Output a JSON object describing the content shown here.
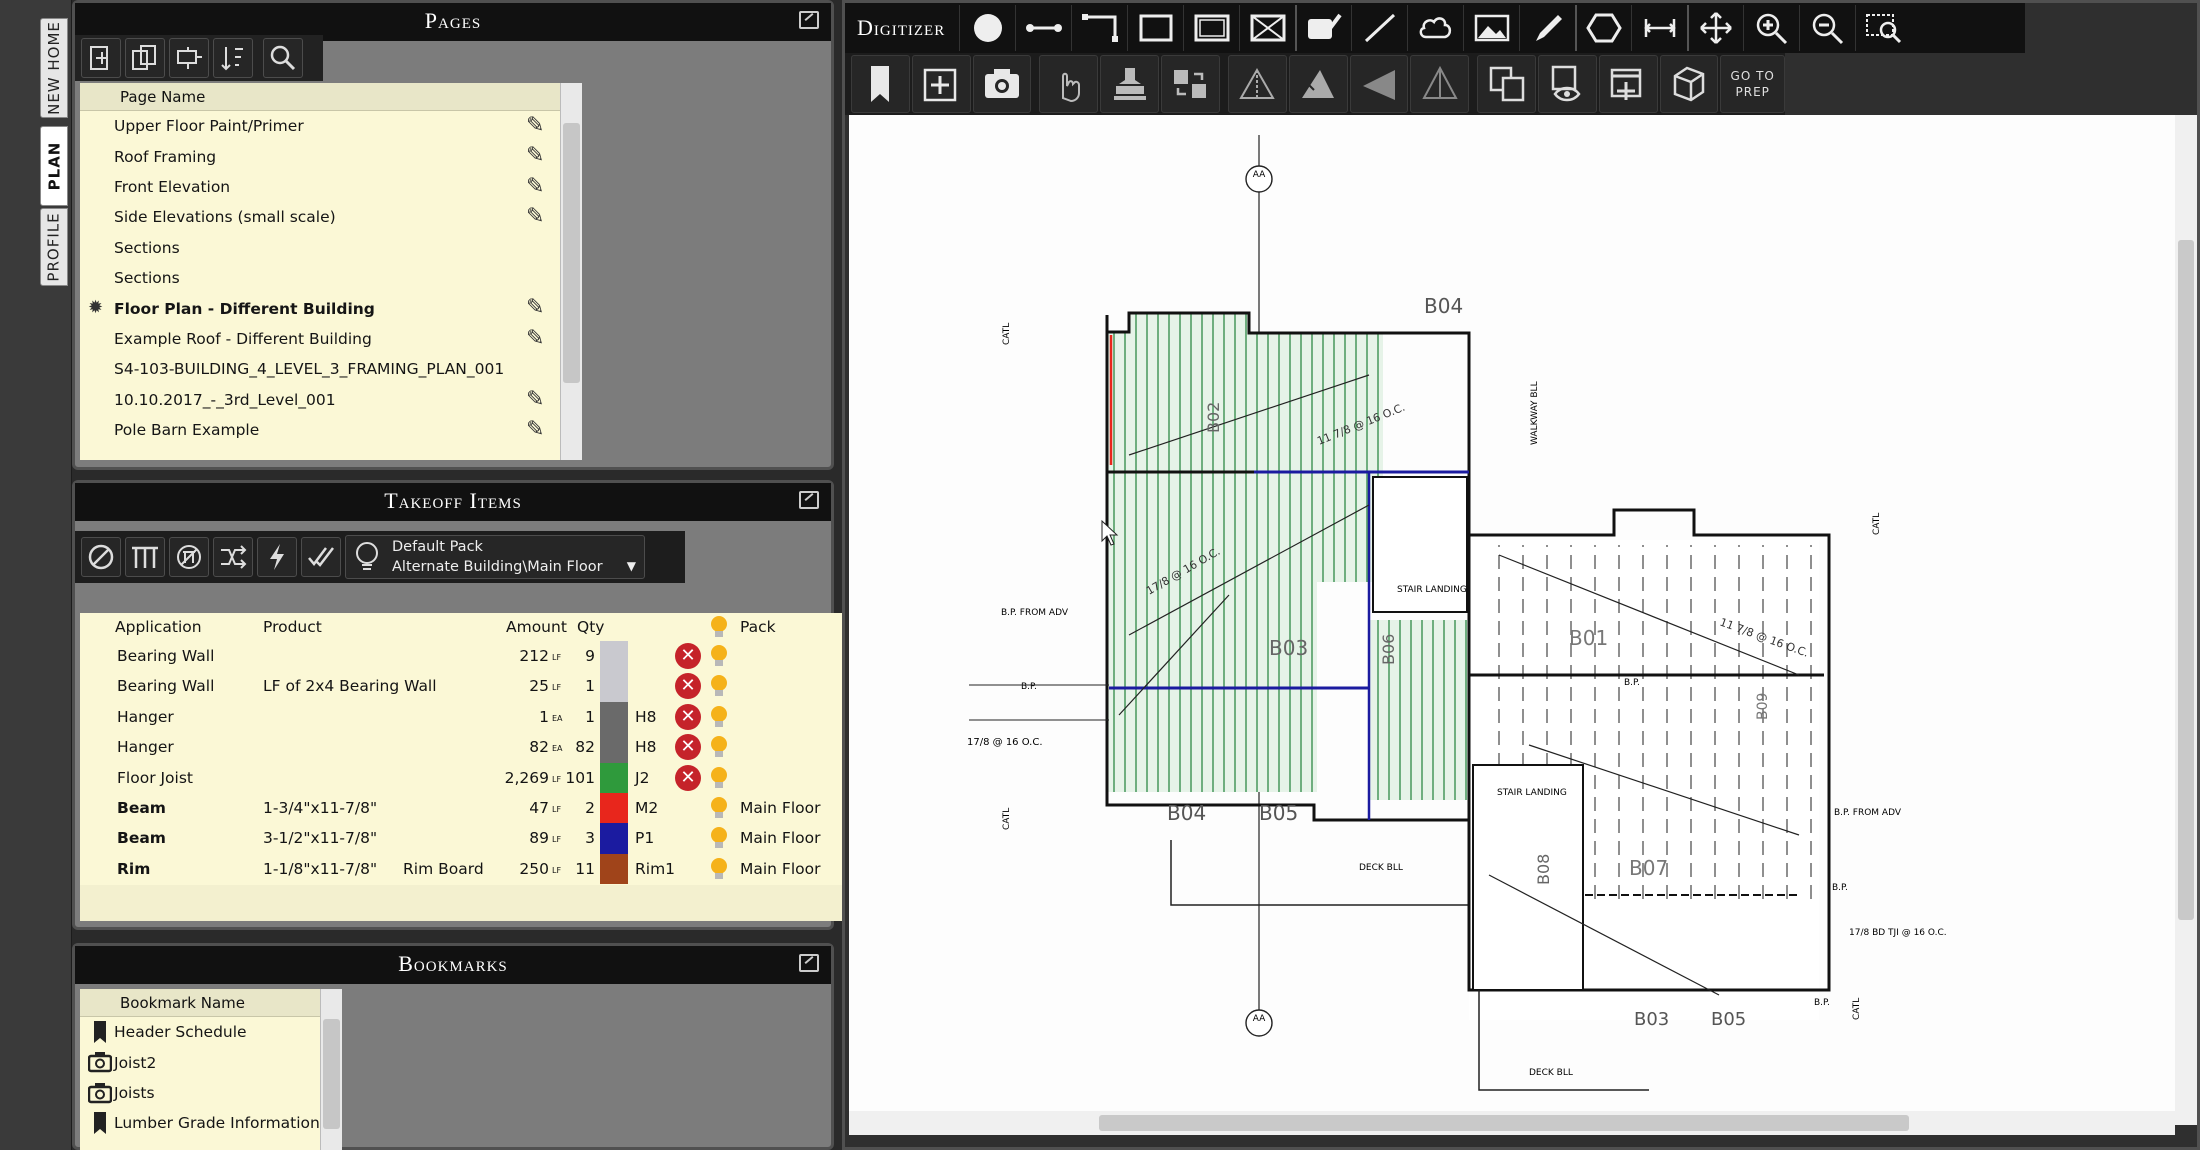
{
  "vertical_tabs": [
    "NEW HOME",
    "PLAN",
    "PROFILE"
  ],
  "pages_panel": {
    "title": "Pages",
    "column_header": "Page Name",
    "items": [
      {
        "label": "Upper Floor Paint/Primer",
        "bold": false,
        "edit": true
      },
      {
        "label": "Roof Framing",
        "bold": false,
        "edit": true
      },
      {
        "label": "Front Elevation",
        "bold": false,
        "edit": true
      },
      {
        "label": "Side Elevations (small scale)",
        "bold": false,
        "edit": true
      },
      {
        "label": "Sections",
        "bold": false,
        "edit": false
      },
      {
        "label": "Sections",
        "bold": false,
        "edit": false
      },
      {
        "label": "Floor Plan - Different Building",
        "bold": true,
        "edit": true,
        "active": true
      },
      {
        "label": "Example Roof - Different Building",
        "bold": false,
        "edit": true
      },
      {
        "label": "S4-103-BUILDING_4_LEVEL_3_FRAMING_PLAN_001",
        "bold": false,
        "edit": false
      },
      {
        "label": "10.10.2017_-_3rd_Level_001",
        "bold": false,
        "edit": true
      },
      {
        "label": "Pole Barn Example",
        "bold": false,
        "edit": true
      }
    ]
  },
  "takeoff_panel": {
    "title": "Takeoff Items",
    "pack_selector": {
      "line1": "Default Pack",
      "line2": "Alternate Building\\Main Floor"
    },
    "columns": {
      "application": "Application",
      "product": "Product",
      "amount": "Amount",
      "qty": "Qty",
      "pack": "Pack"
    },
    "rows": [
      {
        "application": "Bearing Wall",
        "product": "",
        "extra": "",
        "amount": "212",
        "unit": "LF",
        "qty": "9",
        "code": "",
        "color": "#c9c9cf",
        "delete": true,
        "pack": "",
        "bold": false
      },
      {
        "application": "Bearing Wall",
        "product": "LF of 2x4 Bearing Wall",
        "extra": "",
        "amount": "25",
        "unit": "LF",
        "qty": "1",
        "code": "",
        "color": "#c9c9cf",
        "delete": true,
        "pack": "",
        "bold": false
      },
      {
        "application": "Hanger",
        "product": "",
        "extra": "",
        "amount": "1",
        "unit": "EA",
        "qty": "1",
        "code": "H8",
        "color": "#6a6a6a",
        "delete": true,
        "pack": "",
        "bold": false
      },
      {
        "application": "Hanger",
        "product": "",
        "extra": "",
        "amount": "82",
        "unit": "EA",
        "qty": "82",
        "code": "H8",
        "color": "#6a6a6a",
        "delete": true,
        "pack": "",
        "bold": false
      },
      {
        "application": "Floor Joist",
        "product": "",
        "extra": "",
        "amount": "2,269",
        "unit": "LF",
        "qty": "101",
        "code": "J2",
        "color": "#2f9a3c",
        "delete": true,
        "pack": "",
        "bold": false
      },
      {
        "application": "Beam",
        "product": "1-3/4\"x11-7/8\"",
        "extra": "",
        "amount": "47",
        "unit": "LF",
        "qty": "2",
        "code": "M2",
        "color": "#e8261c",
        "delete": false,
        "pack": "Main Floor",
        "bold": true
      },
      {
        "application": "Beam",
        "product": "3-1/2\"x11-7/8\"",
        "extra": "",
        "amount": "89",
        "unit": "LF",
        "qty": "3",
        "code": "P1",
        "color": "#1b1ba0",
        "delete": false,
        "pack": "Main Floor",
        "bold": true
      },
      {
        "application": "Rim",
        "product": "1-1/8\"x11-7/8\"",
        "extra": "Rim Board",
        "amount": "250",
        "unit": "LF",
        "qty": "11",
        "code": "Rim1",
        "color": "#a0441a",
        "delete": false,
        "pack": "Main Floor",
        "bold": true
      }
    ]
  },
  "bookmarks_panel": {
    "title": "Bookmarks",
    "column_header": "Bookmark Name",
    "items": [
      {
        "label": "Header Schedule",
        "icon": "bookmark-icon"
      },
      {
        "label": "Joist2",
        "icon": "camera-icon"
      },
      {
        "label": "Joists",
        "icon": "camera-icon"
      },
      {
        "label": "Lumber Grade Information",
        "icon": "bookmark-icon"
      }
    ]
  },
  "digitizer": {
    "title": "Digitizer",
    "go_to_prep_line1": "GO TO",
    "go_to_prep_line2": "PREP"
  },
  "plan_labels": {
    "grid_top": "AA",
    "grid_bottom": "AA",
    "b04_top": "B04",
    "b04_bottom": "B04",
    "b03": "B03",
    "b02": "B02",
    "b01": "B01",
    "b05": "B05",
    "b05b": "B05",
    "b03b": "B03",
    "b06": "B06",
    "b07": "B07",
    "b08": "B08",
    "b09": "B09",
    "stair_landing_1": "STAIR LANDING",
    "stair_landing_2": "STAIR LANDING",
    "deck_bll_1": "DECK BLL",
    "deck_bll_2": "DECK BLL",
    "joist_note_1": "17/8 @ 16 O.C.",
    "joist_note_2": "11 7/8 @ 16 O.C.",
    "joist_note_3": "17/8 BD TJI @ 16 O.C.",
    "catl_1": "CATL",
    "catl_2": "CATL",
    "catl_3": "CATL",
    "catl_4": "CATL",
    "bp_from_adv_1": "B.P. FROM ADV",
    "bp_from_adv_2": "B.P. FROM ADV",
    "bp_1": "B.P.",
    "bp_2": "B.P.",
    "bp_3": "B.P.",
    "bp_4": "B.P.",
    "walkway_bll": "WALKWAY BLL"
  },
  "colors": {
    "green_joist": "#2f9a3c",
    "red_beam": "#e8261c",
    "blue_beam": "#1b1ba0",
    "rim": "#a0441a",
    "panel_yellow": "#fbf8d6",
    "delete_red": "#c5232a",
    "bulb": "#f5b21a"
  }
}
